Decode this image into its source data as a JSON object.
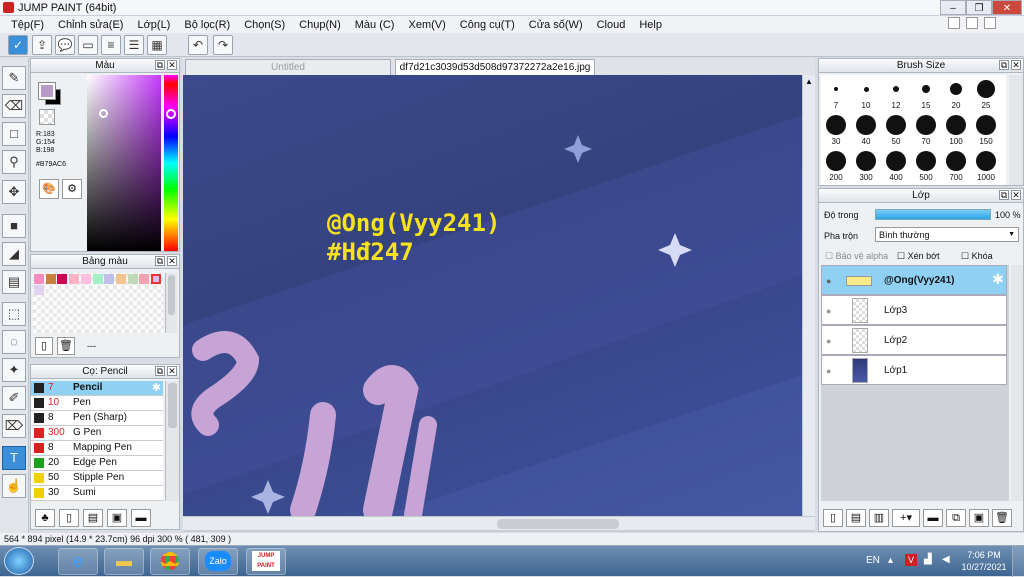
{
  "window": {
    "title": "JUMP PAINT (64bit)"
  },
  "menu": [
    "Tệp(F)",
    "Chỉnh sửa(E)",
    "Lớp(L)",
    "Bộ lọc(R)",
    "Chọn(S)",
    "Chụp(N)",
    "Màu (C)",
    "Xem(V)",
    "Công cụ(T)",
    "Cửa số(W)",
    "Cloud",
    "Help"
  ],
  "tabs": {
    "untitled": "Untitled",
    "active": "df7d21c3039d53d508d97372272a2e16.jpg"
  },
  "color_panel": {
    "title": "Màu",
    "r": "R:183",
    "g": "G:154",
    "b": "B:198",
    "hex": "#B79AC6",
    "fg": "#B79AC6",
    "bg": "#000000"
  },
  "palette_panel": {
    "title": "Bảng màu",
    "dash": "---",
    "swatches": [
      "#f48cbf",
      "#c97f3c",
      "#cc0055",
      "#ffb3c6",
      "#ffc0e0",
      "#a6f0c6",
      "#c0c0e8",
      "#f2c490",
      "#c2d9b8",
      "#f0a2b0",
      "#d9c0f0"
    ]
  },
  "brush_panel": {
    "title": "Cọ: Pencil",
    "items": [
      {
        "size": "7",
        "name": "Pencil",
        "color": "#222222",
        "sizecolor": "#e02020",
        "sel": true
      },
      {
        "size": "10",
        "name": "Pen",
        "color": "#222222",
        "sizecolor": "#e02020"
      },
      {
        "size": "8",
        "name": "Pen (Sharp)",
        "color": "#222222",
        "sizecolor": "#111111"
      },
      {
        "size": "300",
        "name": "G Pen",
        "color": "#e02020",
        "sizecolor": "#e02020"
      },
      {
        "size": "8",
        "name": "Mapping Pen",
        "color": "#e02020",
        "sizecolor": "#111111"
      },
      {
        "size": "20",
        "name": "Edge Pen",
        "color": "#1aa01a",
        "sizecolor": "#111111"
      },
      {
        "size": "50",
        "name": "Stipple Pen",
        "color": "#f0d000",
        "sizecolor": "#111111"
      },
      {
        "size": "30",
        "name": "Sumi",
        "color": "#f0d000",
        "sizecolor": "#111111"
      }
    ]
  },
  "brush_size": {
    "title": "Brush Size",
    "sizes": [
      "7",
      "10",
      "12",
      "15",
      "20",
      "25",
      "30",
      "40",
      "50",
      "70",
      "100",
      "150",
      "200",
      "300",
      "400",
      "500",
      "700",
      "1000"
    ]
  },
  "layer_panel": {
    "title": "Lớp",
    "opacity_label": "Độ trong",
    "opacity": "100 %",
    "blend_label": "Pha trộn",
    "blend": "Bình thường",
    "protect_alpha": "Bảo vệ alpha",
    "clip": "Xén bớt",
    "lock": "Khóa",
    "layers": [
      "@Ong(Vyy241)",
      "Lớp3",
      "Lớp2",
      "Lớp1"
    ]
  },
  "canvas_text": {
    "line1": "@Ong(Vyy241)",
    "line2": "#Hđ247"
  },
  "status": "564 * 894 pixel   (14.9 * 23.7cm)   96 dpi   300 %   ( 481, 309 )",
  "taskbar": {
    "lang": "EN",
    "time": "7:06 PM",
    "date": "10/27/2021",
    "zalo": "Zalo",
    "jump": "JUMP PAINT"
  }
}
